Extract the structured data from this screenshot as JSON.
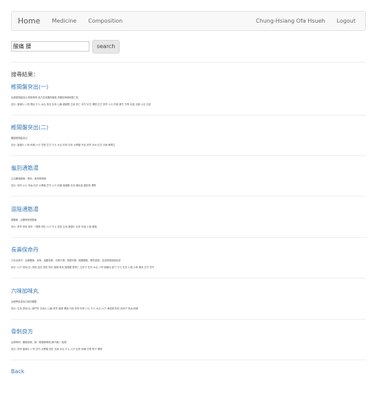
{
  "navbar": {
    "brand": "Home",
    "links": [
      "Medicine",
      "Composition"
    ],
    "user": "Chung-Hsiang Ofa Hsueh",
    "logout": "Logout"
  },
  "search": {
    "value": "酸痛 腰",
    "button": "search"
  },
  "results_title": "搜尋結果：",
  "entries": [
    {
      "title": "椎間盤突出(一)",
      "desc": "治療椎間盤突出,脊椎側彎,各方急成腰部痛風,會腰部骨痛和頸三粒",
      "comp": "成分: 當歸片 川芎 獨活 牛七 木瓜 黃芪 杜仲 山藥 續斷酸 生地 熟仁 赤芍 紅花 澤蘭 白芷 黃芩 川七 防風 秦艽 甘草 乳香 沒藥 川島 白芨"
    },
    {
      "title": "椎間盤突出(二)",
      "desc": "腰腿椎間盤突出",
      "comp": "成分: 當歸片 川芎 碎補 六汗 豆根 生芍 牛七 木瓜 別甲 杜仲 大棗葉 丹皮 黃芩 赤木 紅花 天麻 桑寄生"
    },
    {
      "title": "龜別通筋湯",
      "desc": "主治腰痛腿痛、骨刺、風濕神經痛",
      "comp": "成分: 別甲 川七 甲龜 紅花 大棗葉 豆芍 六汗 碎補 當歸酸 杜仲 桑乳羨 雞知黃 澤寄"
    },
    {
      "title": "滋陰通筋湯",
      "desc": "退腰痛，治腰骨風濕酸痛",
      "comp": "成分: 黃芩 熟地 別甲 一棵根 熟紅 六汗 牛七 桂枝 生地 當歸片 杜仲 甲龜 小茴 路路"
    },
    {
      "title": "長壽保命丹",
      "desc": "又名百歲丹，治療腰痛、耳鳴、遺腰寫痛、月經不調、頭昏失眠、膝腿酸軟、體質虛弱，並滋神經衰弱症狀",
      "comp": "成分: 六汗 熟地(五) 肉蓯 遠志 黃芪 熟紅 當歸 首烏 當歸龍 雲苓仁 生杞子 杜仲 木瓜 川芎 細葉仙 鬱寸 牛七 紅花 小茴 沙參 銀耳 生芍 豆芍"
    },
    {
      "title": "六味加味丸",
      "desc": "治療腎陰虛症引起的腰酸",
      "comp": "成分: 生地 熟地(五) 麥門冬 五味片 山藥 黃芩 當歸 澤蓮 丹皮 茯苓 別甲 川七 牛七 木瓜 六汗 海藻根 枸杞 巡絲子 熟龜 碎補"
    },
    {
      "title": "骨刺良方",
      "desc": "治療骨刺、腰腿疼痛，與一條腿痛痺風(痛不著)一起隨",
      "comp": "成分: 別甲 當歸片 川芎 豆芍 大棗葉 熟紅 天麻 木瓜 牛七 六汗 杜仲 碎補 甘草 附子 澤瀉"
    }
  ],
  "back": "Back"
}
